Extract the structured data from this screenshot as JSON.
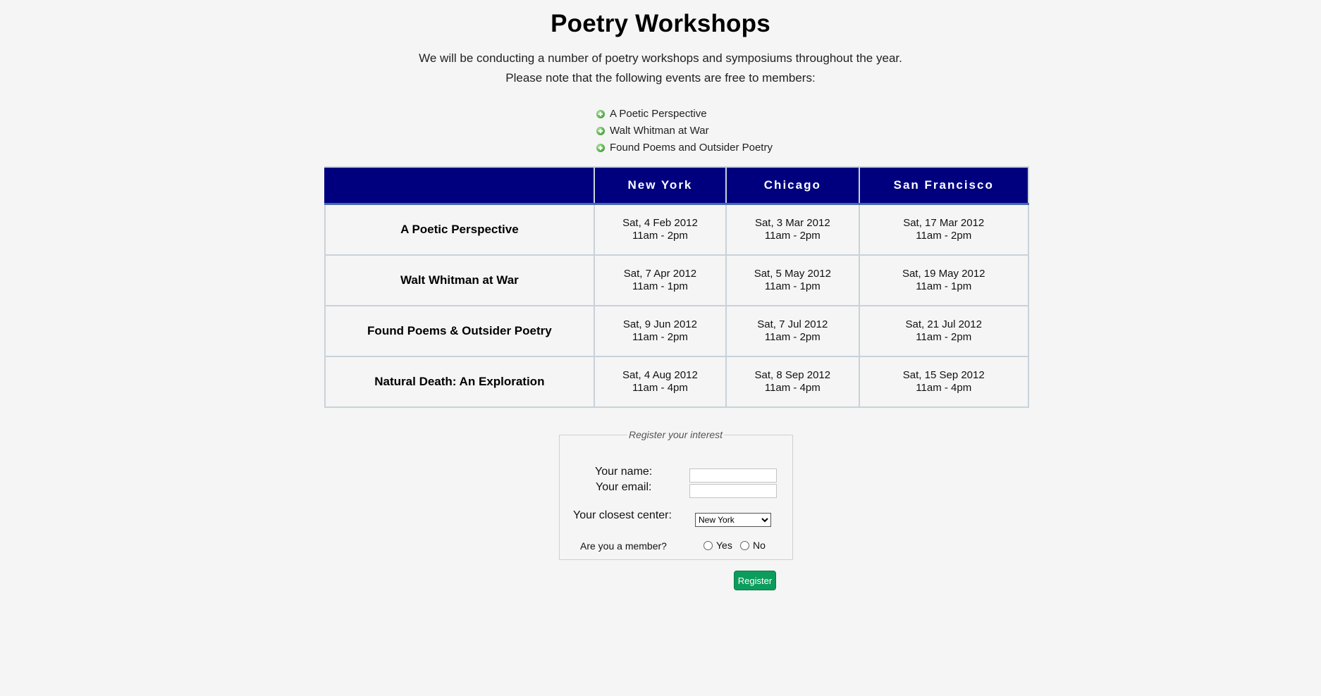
{
  "page": {
    "title": "Poetry Workshops",
    "intro_line1": "We will be conducting a number of poetry workshops and symposiums throughout the year.",
    "intro_line2": "Please note that the following events are free to members:"
  },
  "free_events": [
    {
      "label": "A Poetic Perspective",
      "icon": "green-plus-bullet-icon"
    },
    {
      "label": "Walt Whitman at War",
      "icon": "green-plus-bullet-icon"
    },
    {
      "label": "Found Poems and Outsider Poetry",
      "icon": "green-plus-bullet-icon"
    }
  ],
  "schedule": {
    "header_color": "#00007f",
    "columns": [
      "",
      "New York",
      "Chicago",
      "San Francisco"
    ],
    "rows": [
      {
        "event": "A Poetic Perspective",
        "new_york": {
          "date": "Sat, 4 Feb 2012",
          "time": "11am - 2pm"
        },
        "chicago": {
          "date": "Sat, 3 Mar 2012",
          "time": "11am - 2pm"
        },
        "san_francisco": {
          "date": "Sat, 17 Mar 2012",
          "time": "11am - 2pm"
        }
      },
      {
        "event": "Walt Whitman at War",
        "new_york": {
          "date": "Sat, 7 Apr 2012",
          "time": "11am - 1pm"
        },
        "chicago": {
          "date": "Sat, 5 May 2012",
          "time": "11am - 1pm"
        },
        "san_francisco": {
          "date": "Sat, 19 May 2012",
          "time": "11am - 1pm"
        }
      },
      {
        "event": "Found Poems & Outsider Poetry",
        "new_york": {
          "date": "Sat, 9 Jun 2012",
          "time": "11am - 2pm"
        },
        "chicago": {
          "date": "Sat, 7 Jul 2012",
          "time": "11am - 2pm"
        },
        "san_francisco": {
          "date": "Sat, 21 Jul 2012",
          "time": "11am - 2pm"
        }
      },
      {
        "event": "Natural Death: An Exploration",
        "new_york": {
          "date": "Sat, 4 Aug 2012",
          "time": "11am - 4pm"
        },
        "chicago": {
          "date": "Sat, 8 Sep 2012",
          "time": "11am - 4pm"
        },
        "san_francisco": {
          "date": "Sat, 15 Sep 2012",
          "time": "11am - 4pm"
        }
      }
    ]
  },
  "form": {
    "legend": "Register your interest",
    "name_label": "Your name:",
    "name_value": "",
    "email_label": "Your email:",
    "email_value": "",
    "center_label": "Your closest center:",
    "center_selected": "New York",
    "member_label": "Are you a member?",
    "member_yes": "Yes",
    "member_no": "No",
    "submit_label": "Register",
    "submit_color": "#0c9c5c"
  }
}
